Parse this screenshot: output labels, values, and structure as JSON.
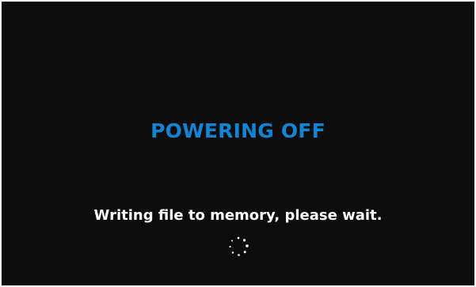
{
  "screen": {
    "title": "POWERING OFF",
    "message": "Writing file to memory, please wait.",
    "spinner_icon": "loading-spinner-icon"
  },
  "colors": {
    "background": "#0d0d0d",
    "title": "#1383d4",
    "message": "#ffffff",
    "spinner": "#ffffff"
  }
}
